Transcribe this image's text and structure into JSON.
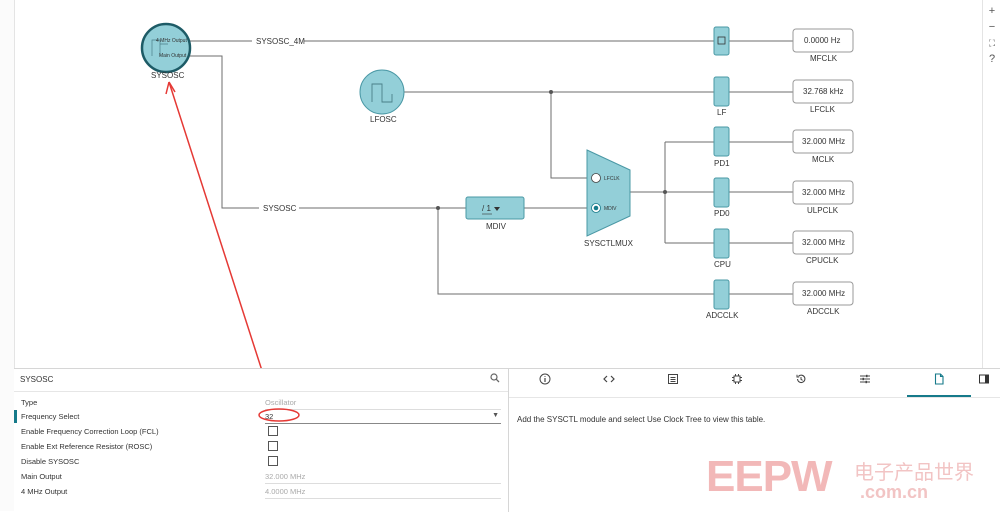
{
  "diagram": {
    "sysosc": {
      "label": "SYSOSC",
      "out_4m": "4 MHz Output",
      "out_main": "Main Output"
    },
    "lfosc": {
      "label": "LFOSC"
    },
    "wires": {
      "sysosc_4m": "SYSOSC_4M",
      "sysosc": "SYSOSC"
    },
    "mdiv": {
      "label": "MDIV",
      "value": "/ 1"
    },
    "mux": {
      "label": "SYSCTLMUX",
      "in_lfclk": "LFCLK",
      "in_mdiv": "MDIV"
    },
    "gates": [
      "",
      "LF",
      "PD1",
      "PD0",
      "CPU",
      "ADCCLK"
    ],
    "outputs": [
      {
        "value": "0.0000 Hz",
        "name": "MFCLK"
      },
      {
        "value": "32.768 kHz",
        "name": "LFCLK"
      },
      {
        "value": "32.000 MHz",
        "name": "MCLK"
      },
      {
        "value": "32.000 MHz",
        "name": "ULPCLK"
      },
      {
        "value": "32.000 MHz",
        "name": "CPUCLK"
      },
      {
        "value": "32.000 MHz",
        "name": "ADCCLK"
      }
    ]
  },
  "zoom": {
    "in": "+",
    "out": "−",
    "fit": "⛶",
    "help": "?"
  },
  "properties": {
    "title": "SYSOSC",
    "rows": [
      {
        "label": "Type",
        "value": "Oscillator"
      },
      {
        "label": "Frequency Select",
        "value": "32"
      },
      {
        "label": "Enable Frequency Correction Loop (FCL)"
      },
      {
        "label": "Enable Ext Reference Resistor (ROSC)"
      },
      {
        "label": "Disable SYSOSC"
      },
      {
        "label": "Main Output",
        "value": "32.000 MHz"
      },
      {
        "label": "4 MHz Output",
        "value": "4.0000 MHz"
      }
    ]
  },
  "help": {
    "message": "Add the SYSCTL module and select Use Clock Tree to view this table."
  },
  "watermark": {
    "logo": "EEPW",
    "cn": "电子产品世界",
    "domain": ".com.cn"
  },
  "colors": {
    "node_fill": "#93cfd8",
    "accent": "#167a8a",
    "annotation": "#e53935"
  }
}
